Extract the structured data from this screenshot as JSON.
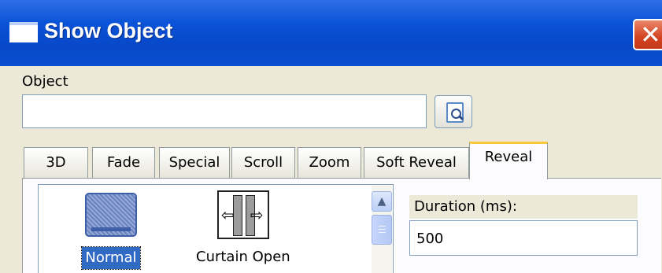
{
  "window": {
    "title": "Show Object",
    "close_symbol": "✕"
  },
  "object": {
    "label": "Object",
    "value": ""
  },
  "tabs": [
    {
      "label": "3D"
    },
    {
      "label": "Fade"
    },
    {
      "label": "Special"
    },
    {
      "label": "Scroll"
    },
    {
      "label": "Zoom"
    },
    {
      "label": "Soft Reveal"
    },
    {
      "label": "Reveal"
    }
  ],
  "active_tab": "Reveal",
  "effects": [
    {
      "label": "Normal",
      "icon": "normal-effect-icon",
      "selected": true
    },
    {
      "label": "Curtain Open",
      "icon": "curtain-open-icon",
      "selected": false
    }
  ],
  "duration": {
    "label": "Duration (ms):",
    "value": "500"
  },
  "colors": {
    "titlebar": "#0a53d8",
    "selection": "#316ac5",
    "active_tab_accent": "#ffc83c"
  }
}
